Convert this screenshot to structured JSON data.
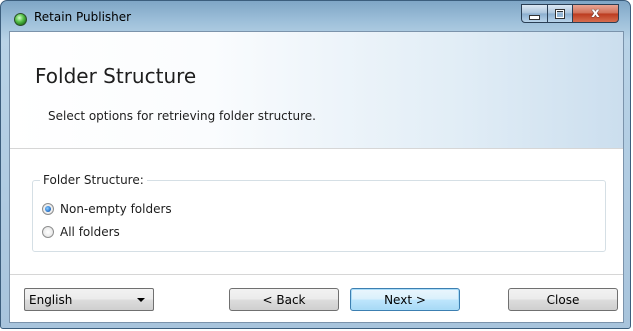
{
  "window": {
    "title": "Retain Publisher",
    "controls": {
      "minimize": "",
      "maximize": "",
      "close": "x"
    }
  },
  "header": {
    "title": "Folder Structure",
    "subtitle": "Select options for retrieving folder structure."
  },
  "folder_group": {
    "legend": "Folder Structure:",
    "options": [
      {
        "label": "Non-empty folders",
        "checked": true
      },
      {
        "label": "All folders",
        "checked": false
      }
    ]
  },
  "footer": {
    "language": "English",
    "back_label": "< Back",
    "next_label": "Next >",
    "close_label": "Close"
  }
}
